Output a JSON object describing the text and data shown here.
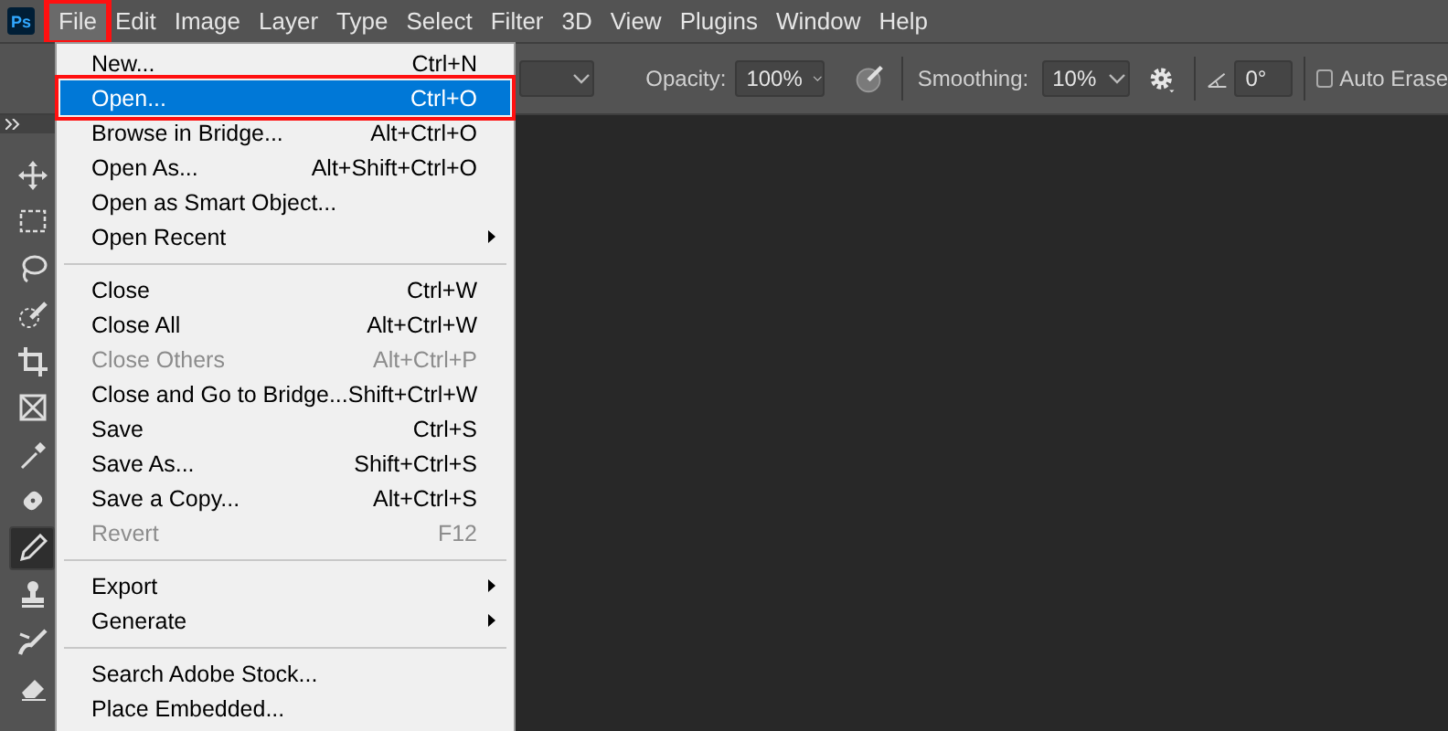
{
  "app_logo": "Ps",
  "menu_bar": [
    {
      "label": "File",
      "selected": true,
      "annotated": true
    },
    {
      "label": "Edit",
      "selected": false,
      "annotated": false
    },
    {
      "label": "Image",
      "selected": false,
      "annotated": false
    },
    {
      "label": "Layer",
      "selected": false,
      "annotated": false
    },
    {
      "label": "Type",
      "selected": false,
      "annotated": false
    },
    {
      "label": "Select",
      "selected": false,
      "annotated": false
    },
    {
      "label": "Filter",
      "selected": false,
      "annotated": false
    },
    {
      "label": "3D",
      "selected": false,
      "annotated": false
    },
    {
      "label": "View",
      "selected": false,
      "annotated": false
    },
    {
      "label": "Plugins",
      "selected": false,
      "annotated": false
    },
    {
      "label": "Window",
      "selected": false,
      "annotated": false
    },
    {
      "label": "Help",
      "selected": false,
      "annotated": false
    }
  ],
  "options_bar": {
    "opacity_label": "Opacity:",
    "opacity": "100%",
    "smoothing_label": "Smoothing:",
    "smoothing": "10%",
    "angle": "0°",
    "auto_erase": {
      "label": "Auto Erase",
      "checked": false
    }
  },
  "toolbar": {
    "tools": [
      {
        "kind": "move",
        "selected": false
      },
      {
        "kind": "marquee",
        "selected": false
      },
      {
        "kind": "lasso",
        "selected": false
      },
      {
        "kind": "quick-selection",
        "selected": false
      },
      {
        "kind": "crop",
        "selected": false
      },
      {
        "kind": "frame",
        "selected": false
      },
      {
        "kind": "eyedropper",
        "selected": false
      },
      {
        "kind": "healing",
        "selected": false
      },
      {
        "kind": "pencil",
        "selected": true
      },
      {
        "kind": "stamp",
        "selected": false
      },
      {
        "kind": "history-brush",
        "selected": false
      },
      {
        "kind": "eraser",
        "selected": false
      }
    ]
  },
  "file_menu": {
    "items": [
      {
        "kind": "item",
        "label": "New...",
        "shortcut": "Ctrl+N",
        "disabled": false,
        "selected": false,
        "annotated": false,
        "submenu": false
      },
      {
        "kind": "item",
        "label": "Open...",
        "shortcut": "Ctrl+O",
        "disabled": false,
        "selected": true,
        "annotated": true,
        "submenu": false
      },
      {
        "kind": "item",
        "label": "Browse in Bridge...",
        "shortcut": "Alt+Ctrl+O",
        "disabled": false,
        "selected": false,
        "annotated": false,
        "submenu": false
      },
      {
        "kind": "item",
        "label": "Open As...",
        "shortcut": "Alt+Shift+Ctrl+O",
        "disabled": false,
        "selected": false,
        "annotated": false,
        "submenu": false
      },
      {
        "kind": "item",
        "label": "Open as Smart Object...",
        "disabled": false,
        "selected": false,
        "annotated": false,
        "submenu": false
      },
      {
        "kind": "item",
        "label": "Open Recent",
        "disabled": false,
        "selected": false,
        "annotated": false,
        "submenu": true
      },
      {
        "kind": "separator"
      },
      {
        "kind": "item",
        "label": "Close",
        "shortcut": "Ctrl+W",
        "disabled": false,
        "selected": false,
        "annotated": false,
        "submenu": false
      },
      {
        "kind": "item",
        "label": "Close All",
        "shortcut": "Alt+Ctrl+W",
        "disabled": false,
        "selected": false,
        "annotated": false,
        "submenu": false
      },
      {
        "kind": "item",
        "label": "Close Others",
        "shortcut": "Alt+Ctrl+P",
        "disabled": true,
        "selected": false,
        "annotated": false,
        "submenu": false
      },
      {
        "kind": "item",
        "label": "Close and Go to Bridge...",
        "shortcut": "Shift+Ctrl+W",
        "disabled": false,
        "selected": false,
        "annotated": false,
        "submenu": false
      },
      {
        "kind": "item",
        "label": "Save",
        "shortcut": "Ctrl+S",
        "disabled": false,
        "selected": false,
        "annotated": false,
        "submenu": false
      },
      {
        "kind": "item",
        "label": "Save As...",
        "shortcut": "Shift+Ctrl+S",
        "disabled": false,
        "selected": false,
        "annotated": false,
        "submenu": false
      },
      {
        "kind": "item",
        "label": "Save a Copy...",
        "shortcut": "Alt+Ctrl+S",
        "disabled": false,
        "selected": false,
        "annotated": false,
        "submenu": false
      },
      {
        "kind": "item",
        "label": "Revert",
        "shortcut": "F12",
        "disabled": true,
        "selected": false,
        "annotated": false,
        "submenu": false
      },
      {
        "kind": "separator"
      },
      {
        "kind": "item",
        "label": "Export",
        "disabled": false,
        "selected": false,
        "annotated": false,
        "submenu": true
      },
      {
        "kind": "item",
        "label": "Generate",
        "disabled": false,
        "selected": false,
        "annotated": false,
        "submenu": true
      },
      {
        "kind": "separator"
      },
      {
        "kind": "item",
        "label": "Search Adobe Stock...",
        "disabled": false,
        "selected": false,
        "annotated": false,
        "submenu": false
      },
      {
        "kind": "item",
        "label": "Place Embedded...",
        "disabled": false,
        "selected": false,
        "annotated": false,
        "submenu": false
      }
    ]
  }
}
